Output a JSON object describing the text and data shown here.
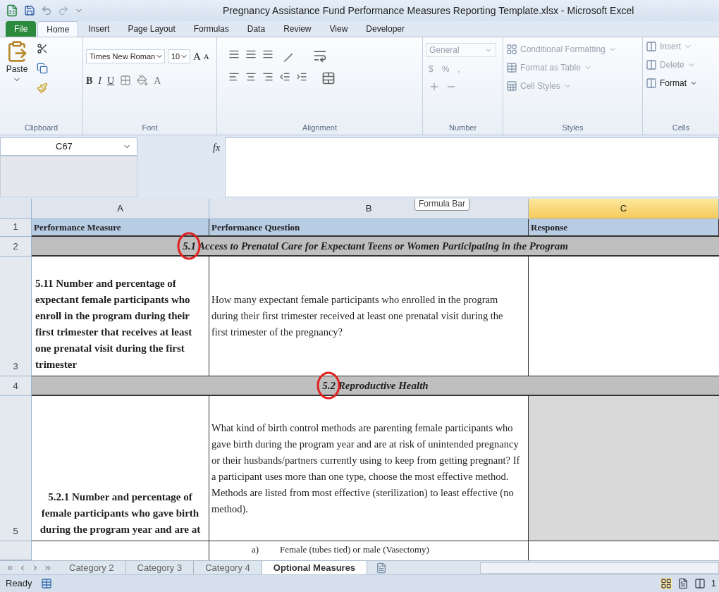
{
  "window": {
    "title": "Pregnancy Assistance Fund Performance Measures Reporting Template.xlsx - Microsoft Excel"
  },
  "ribbon_tabs": [
    {
      "label": "File",
      "kind": "file",
      "selected": false
    },
    {
      "label": "Home",
      "kind": "tab",
      "selected": true
    },
    {
      "label": "Insert",
      "kind": "tab",
      "selected": false
    },
    {
      "label": "Page Layout",
      "kind": "tab",
      "selected": false
    },
    {
      "label": "Formulas",
      "kind": "tab",
      "selected": false
    },
    {
      "label": "Data",
      "kind": "tab",
      "selected": false
    },
    {
      "label": "Review",
      "kind": "tab",
      "selected": false
    },
    {
      "label": "View",
      "kind": "tab",
      "selected": false
    },
    {
      "label": "Developer",
      "kind": "tab",
      "selected": false
    }
  ],
  "ribbon": {
    "clipboard": {
      "label": "Clipboard",
      "paste": "Paste"
    },
    "font": {
      "label": "Font",
      "font_name": "Times New Roman",
      "font_size": "10",
      "bold": "B",
      "italic": "I",
      "underline": "U",
      "grow": "A",
      "shrink": "A",
      "font_color_label": "A"
    },
    "alignment": {
      "label": "Alignment"
    },
    "number": {
      "label": "Number",
      "format": "General",
      "currency": "$",
      "percent": "%",
      "comma": ",",
      "disabled": true
    },
    "styles": {
      "label": "Styles",
      "items": [
        {
          "label": "Conditional Formatting",
          "disabled": true
        },
        {
          "label": "Format as Table",
          "disabled": true
        },
        {
          "label": "Cell Styles",
          "disabled": true
        }
      ]
    },
    "cells": {
      "label": "Cells",
      "items": [
        {
          "label": "Insert",
          "disabled": true
        },
        {
          "label": "Delete",
          "disabled": true
        },
        {
          "label": "Format",
          "disabled": false
        }
      ]
    }
  },
  "formula_bar": {
    "name_box": "C67",
    "function_label": "fx",
    "tooltip": "Formula Bar"
  },
  "sheet": {
    "columns": [
      {
        "label": "A",
        "selected": false
      },
      {
        "label": "B",
        "selected": false
      },
      {
        "label": "C",
        "selected": true
      }
    ],
    "rows": [
      {
        "number": "1",
        "kind": "header",
        "cells": [
          "Performance Measure",
          "Performance Question",
          "Response"
        ]
      },
      {
        "number": "2",
        "kind": "section",
        "title": "5.1 Access to Prenatal Care for Expectant Teens or Women Participating in the Program"
      },
      {
        "number": "3",
        "kind": "data",
        "measure": "5.11 Number and percentage of expectant female participants who enroll in the program during their first trimester that receives at least one prenatal visit during the first trimester",
        "measure_centered": false,
        "question": "How many expectant female participants who enrolled in the program during their first trimester received at least one prenatal visit during the first trimester of the pregnancy?",
        "response_shaded": false
      },
      {
        "number": "4",
        "kind": "section",
        "title": "5.2 Reproductive Health"
      },
      {
        "number": "5",
        "kind": "data",
        "measure": "5.2.1 Number and percentage of female participants who gave birth during the program year and are at",
        "measure_centered": true,
        "question": "What kind of birth control methods are parenting female participants who gave birth during the program year and are at risk of unintended pregnancy or their husbands/partners currently using to keep from getting pregnant? If a participant uses more than one type, choose the most effective method. Methods are listed from most effective (sterilization) to least effective (no method).",
        "response_shaded": true
      },
      {
        "kind": "option",
        "marker": "a)",
        "option": "Female (tubes tied) or male (Vasectomy)"
      }
    ]
  },
  "sheet_tabs": [
    {
      "label": "Category 2",
      "selected": false
    },
    {
      "label": "Category 3",
      "selected": false
    },
    {
      "label": "Category 4",
      "selected": false
    },
    {
      "label": "Optional Measures",
      "selected": true
    }
  ],
  "status_bar": {
    "status": "Ready",
    "zoom": "1"
  }
}
